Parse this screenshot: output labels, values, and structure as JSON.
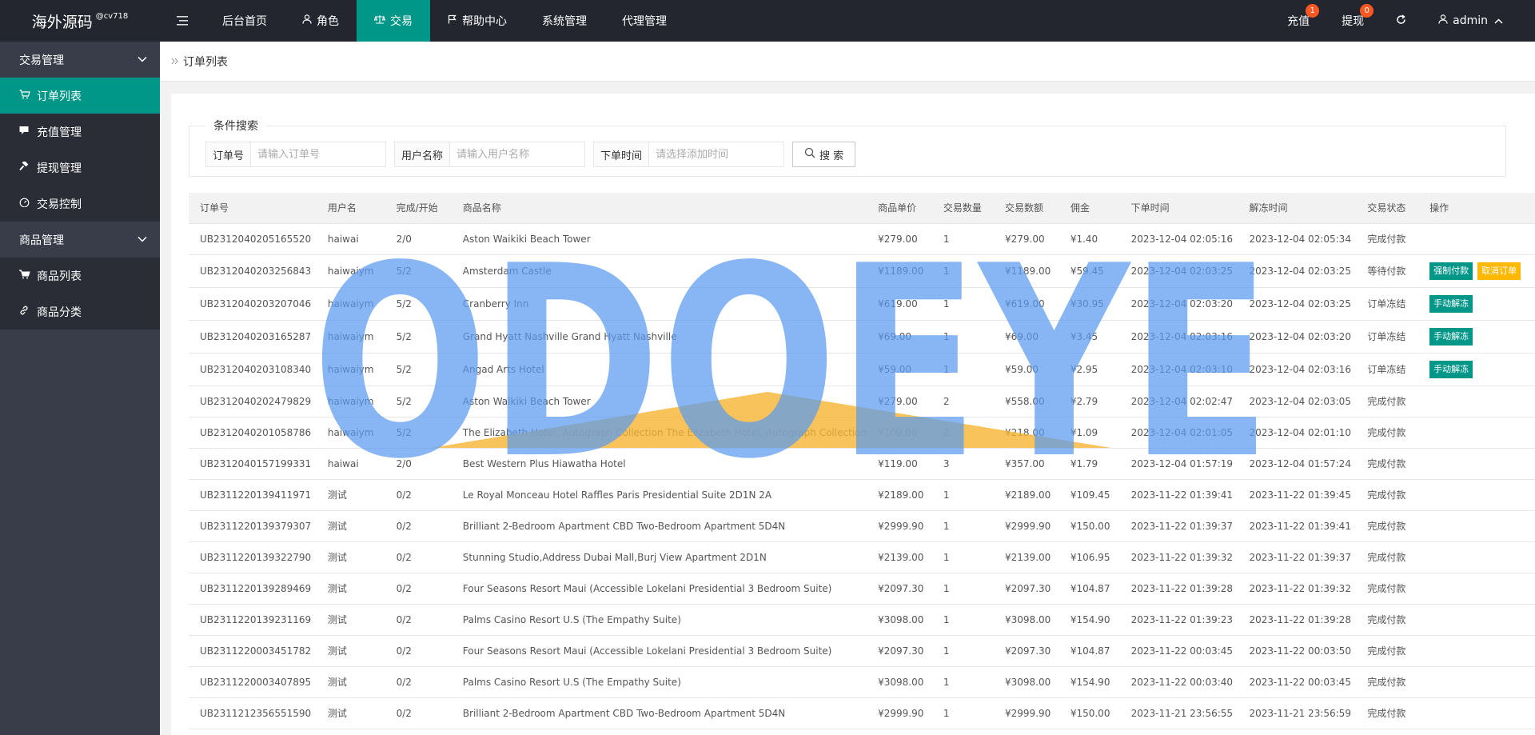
{
  "header": {
    "logo": "海外源码",
    "logo_sup": "@cv718",
    "nav": [
      {
        "label": "后台首页",
        "icon": ""
      },
      {
        "label": "角色",
        "icon": "user-icon"
      },
      {
        "label": "交易",
        "icon": "scale-icon",
        "active": true
      },
      {
        "label": "帮助中心",
        "icon": "flag-icon"
      },
      {
        "label": "系统管理",
        "icon": ""
      },
      {
        "label": "代理管理",
        "icon": ""
      }
    ],
    "recharge": {
      "label": "充值",
      "badge": "1"
    },
    "withdraw": {
      "label": "提现",
      "badge": "0"
    },
    "user": "admin"
  },
  "sidebar": {
    "group1": "交易管理",
    "items1": [
      {
        "label": "订单列表",
        "icon": "cart-icon"
      },
      {
        "label": "充值管理",
        "icon": "chat-icon"
      },
      {
        "label": "提现管理",
        "icon": "hammer-icon"
      },
      {
        "label": "交易控制",
        "icon": "gauge-icon"
      }
    ],
    "group2": "商品管理",
    "items2": [
      {
        "label": "商品列表",
        "icon": "cart-icon"
      },
      {
        "label": "商品分类",
        "icon": "link-icon"
      }
    ]
  },
  "breadcrumb": "订单列表",
  "search": {
    "legend": "条件搜索",
    "order_label": "订单号",
    "order_placeholder": "请输入订单号",
    "user_label": "用户名称",
    "user_placeholder": "请输入用户名称",
    "time_label": "下单时间",
    "time_placeholder": "请选择添加时间",
    "button": "搜 索"
  },
  "table": {
    "headers": [
      "订单号",
      "用户名",
      "完成/开始",
      "商品名称",
      "商品单价",
      "交易数量",
      "交易数额",
      "佣金",
      "下单时间",
      "解冻时间",
      "交易状态",
      "操作"
    ],
    "rows": [
      [
        "UB2312040205165520",
        "haiwai",
        "2/0",
        "Aston Waikiki Beach Tower",
        "¥279.00",
        "1",
        "¥279.00",
        "¥1.40",
        "2023-12-04 02:05:16",
        "2023-12-04 02:05:34",
        "完成付款",
        ""
      ],
      [
        "UB2312040203256843",
        "haiwaiym",
        "5/2",
        "Amsterdam Castle",
        "¥1189.00",
        "1",
        "¥1189.00",
        "¥59.45",
        "2023-12-04 02:03:25",
        "2023-12-04 02:03:25",
        "等待付款",
        "pay_cancel"
      ],
      [
        "UB2312040203207046",
        "haiwaiym",
        "5/2",
        "Cranberry Inn",
        "¥619.00",
        "1",
        "¥619.00",
        "¥30.95",
        "2023-12-04 02:03:20",
        "2023-12-04 02:03:25",
        "订单冻结",
        "unfreeze"
      ],
      [
        "UB2312040203165287",
        "haiwaiym",
        "5/2",
        "Grand Hyatt Nashville Grand Hyatt Nashville",
        "¥69.00",
        "1",
        "¥69.00",
        "¥3.45",
        "2023-12-04 02:03:16",
        "2023-12-04 02:03:20",
        "订单冻结",
        "unfreeze"
      ],
      [
        "UB2312040203108340",
        "haiwaiym",
        "5/2",
        "Angad Arts Hotel",
        "¥59.00",
        "1",
        "¥59.00",
        "¥2.95",
        "2023-12-04 02:03:10",
        "2023-12-04 02:03:16",
        "订单冻结",
        "unfreeze"
      ],
      [
        "UB2312040202479829",
        "haiwaiym",
        "5/2",
        "Aston Waikiki Beach Tower",
        "¥279.00",
        "2",
        "¥558.00",
        "¥2.79",
        "2023-12-04 02:02:47",
        "2023-12-04 02:03:05",
        "完成付款",
        ""
      ],
      [
        "UB2312040201058786",
        "haiwaiym",
        "5/2",
        "The Elizabeth Hotel, Autograph Collection The Elizabeth Hotel, Autograph Collection",
        "¥109.00",
        "2",
        "¥218.00",
        "¥1.09",
        "2023-12-04 02:01:05",
        "2023-12-04 02:01:10",
        "完成付款",
        ""
      ],
      [
        "UB2312040157199331",
        "haiwai",
        "2/0",
        "Best Western Plus Hiawatha Hotel",
        "¥119.00",
        "3",
        "¥357.00",
        "¥1.79",
        "2023-12-04 01:57:19",
        "2023-12-04 01:57:24",
        "完成付款",
        ""
      ],
      [
        "UB2311220139411971",
        "测试",
        "0/2",
        "Le Royal Monceau Hotel Raffles Paris Presidential Suite 2D1N 2A",
        "¥2189.00",
        "1",
        "¥2189.00",
        "¥109.45",
        "2023-11-22 01:39:41",
        "2023-11-22 01:39:45",
        "完成付款",
        ""
      ],
      [
        "UB2311220139379307",
        "测试",
        "0/2",
        "Brilliant 2-Bedroom Apartment CBD Two-Bedroom Apartment 5D4N",
        "¥2999.90",
        "1",
        "¥2999.90",
        "¥150.00",
        "2023-11-22 01:39:37",
        "2023-11-22 01:39:41",
        "完成付款",
        ""
      ],
      [
        "UB2311220139322790",
        "测试",
        "0/2",
        "Stunning Studio,Address Dubai Mall,Burj View Apartment 2D1N",
        "¥2139.00",
        "1",
        "¥2139.00",
        "¥106.95",
        "2023-11-22 01:39:32",
        "2023-11-22 01:39:37",
        "完成付款",
        ""
      ],
      [
        "UB2311220139289469",
        "测试",
        "0/2",
        "Four Seasons Resort Maui (Accessible Lokelani Presidential 3 Bedroom Suite)",
        "¥2097.30",
        "1",
        "¥2097.30",
        "¥104.87",
        "2023-11-22 01:39:28",
        "2023-11-22 01:39:32",
        "完成付款",
        ""
      ],
      [
        "UB2311220139231169",
        "测试",
        "0/2",
        "Palms Casino Resort U.S (The Empathy Suite)",
        "¥3098.00",
        "1",
        "¥3098.00",
        "¥154.90",
        "2023-11-22 01:39:23",
        "2023-11-22 01:39:28",
        "完成付款",
        ""
      ],
      [
        "UB2311220003451782",
        "测试",
        "0/2",
        "Four Seasons Resort Maui (Accessible Lokelani Presidential 3 Bedroom Suite)",
        "¥2097.30",
        "1",
        "¥2097.30",
        "¥104.87",
        "2023-11-22 00:03:45",
        "2023-11-22 00:03:50",
        "完成付款",
        ""
      ],
      [
        "UB2311220003407895",
        "测试",
        "0/2",
        "Palms Casino Resort U.S (The Empathy Suite)",
        "¥3098.00",
        "1",
        "¥3098.00",
        "¥154.90",
        "2023-11-22 00:03:40",
        "2023-11-22 00:03:45",
        "完成付款",
        ""
      ],
      [
        "UB2311212356551590",
        "测试",
        "0/2",
        "Brilliant 2-Bedroom Apartment CBD Two-Bedroom Apartment 5D4N",
        "¥2999.90",
        "1",
        "¥2999.90",
        "¥150.00",
        "2023-11-21 23:56:55",
        "2023-11-21 23:56:59",
        "完成付款",
        ""
      ]
    ],
    "op_labels": {
      "force_pay": "强制付款",
      "cancel": "取消订单",
      "unfreeze": "手动解冻"
    }
  },
  "watermark": {
    "text": "ODOEYE",
    "color": "#5b9bf0",
    "accent": "#f8b432"
  },
  "colors": {
    "topbar": "#23262e",
    "sidebar": "#393d49",
    "accent": "#009688",
    "badge": "#ff5722"
  }
}
